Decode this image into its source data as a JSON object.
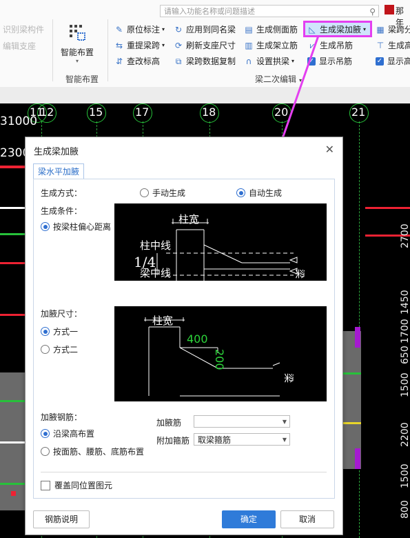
{
  "ribbon": {
    "search_placeholder": "请输入功能名称或问题描述",
    "user_name": "那年",
    "left_commands": [
      "识别梁构件",
      "编辑支座"
    ],
    "big_button": "智能布置",
    "group1_label": "智能布置",
    "group2_label": "梁二次编辑",
    "commands": {
      "c1": "原位标注",
      "c2": "重提梁跨",
      "c3": "查改标高",
      "c4": "应用到同名梁",
      "c5": "刷新支座尺寸",
      "c6": "梁跨数据复制",
      "c7": "生成侧面筋",
      "c8": "生成架立筋",
      "c9": "设置拱梁",
      "c10": "生成梁加腋",
      "c11": "生成吊筋",
      "c12": "显示吊筋",
      "c13": "梁跨分",
      "c14": "生成高",
      "c15": "显示高"
    }
  },
  "cad": {
    "axes": [
      "11",
      "12",
      "15",
      "17",
      "18",
      "20",
      "21"
    ],
    "dim_top": "31000",
    "dim_top2": "2300",
    "dims_right": [
      "2700",
      "1450",
      "1700",
      "650",
      "1500",
      "2200",
      "1500",
      "800"
    ]
  },
  "dialog": {
    "title": "生成梁加腋",
    "tab": "梁水平加腋",
    "gen_mode_label": "生成方式：",
    "mode_manual": "手动生成",
    "mode_auto": "自动生成",
    "gen_cond_label": "生成条件：",
    "cond_option": "按梁柱偏心距离",
    "haunch_size_label": "加腋尺寸：",
    "size_opt1": "方式一",
    "size_opt2": "方式二",
    "rebar_label": "加腋钢筋：",
    "rebar_opt1": "沿梁高布置",
    "rebar_opt2": "按面筋、腰筋、底筋布置",
    "haunch_bar_label": "加腋筋",
    "haunch_bar_value": "",
    "stirrup_label": "附加箍筋",
    "stirrup_value": "取梁箍筋",
    "overwrite_label": "覆盖同位置图元",
    "help_btn": "钢筋说明",
    "ok_btn": "确定",
    "cancel_btn": "取消",
    "img1": {
      "col_width": "柱宽",
      "col_center": "柱中线",
      "ratio": "1/4",
      "beam_center": "梁中线",
      "beam": "梁"
    },
    "img2": {
      "col_width": "柱宽",
      "dim_400": "400",
      "dim_200": "200",
      "beam": "梁"
    }
  }
}
